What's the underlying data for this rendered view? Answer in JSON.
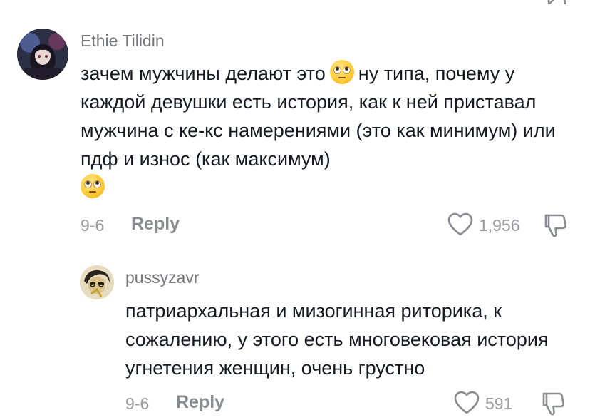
{
  "comment": {
    "username": "Ethie Tilidin",
    "text_before_emoji": "зачем мужчины делают это",
    "text_after_emoji": "ну типа, почему у каждой девушки есть история, как к ней приставал мужчина с ке-кс намерениями (это как минимум) или пдф и износ (как максимум)",
    "emoji": "face-with-rolling-eyes",
    "date": "9-6",
    "reply_label": "Reply",
    "likes": "1,956"
  },
  "reply": {
    "username": "pussyzavr",
    "text": "патриархальная и мизогинная риторика, к сожалению, у этого есть многовековая история угнетения женщин, очень грустно",
    "date": "9-6",
    "reply_label": "Reply",
    "likes": "591"
  },
  "icons": {
    "like": "heart-outline-icon",
    "dislike": "thumbs-down-outline-icon"
  },
  "colors": {
    "text": "#161823",
    "secondary": "#75757d",
    "icon": "#8a8b91"
  }
}
